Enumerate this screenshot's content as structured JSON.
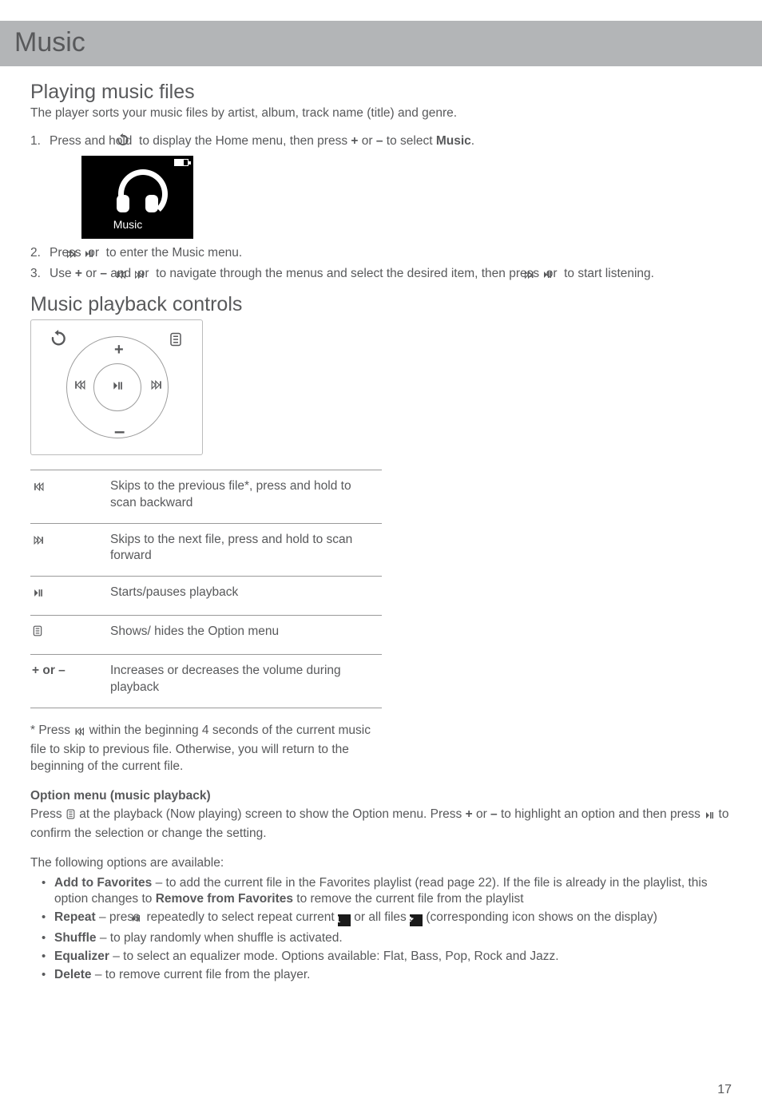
{
  "band": {
    "title": "Music"
  },
  "s1": {
    "heading": "Playing music files",
    "intro": "The player sorts your music files by artist, album, track name (title) and genre.",
    "steps": {
      "s1a": "Press and hold ",
      "s1b": " to display the Home menu, then press ",
      "plus": "+",
      "s1c": " or ",
      "minus": "–",
      "s1d": " to select ",
      "bold1": "Music",
      "s1e": ".",
      "s2a": "Press ",
      "s2b": " or ",
      "s2c": " to enter the Music menu.",
      "s3a": "Use ",
      "s3b": " or ",
      "s3c": " and ",
      "s3d": " or ",
      "s3e": " to navigate through the menus and select the desired item, then press ",
      "s3f": " or ",
      "s3g": " to start listening."
    },
    "thumb_label": "Music"
  },
  "s2": {
    "heading": "Music playback controls",
    "table": {
      "r1": "Skips to the previous file*, press and hold to scan backward",
      "r2": "Skips to the next file, press and hold to scan forward",
      "r3": "Starts/pauses playback",
      "r4": "Shows/ hides the Option menu",
      "r5k": "+ or –",
      "r5": "Increases or decreases the volume during playback"
    },
    "note_a": "* Press ",
    "note_b": " within the beginning 4 seconds of the current music file to skip to previous file. Otherwise, you will return to the beginning of the current file."
  },
  "opt": {
    "head": "Option menu (music playback)",
    "p1a": "Press ",
    "p1b": " at the playback (Now playing) screen to show the Option menu. Press ",
    "plus": "+",
    "p1c": " or ",
    "minus": "–",
    "p1d": " to highlight an option and then press ",
    "p1e": " to confirm the selection or change the setting.",
    "p2": "The following options are available:",
    "li1a": "Add to Favorites",
    "li1b": " – to add the current file in the Favorites playlist (read page 22). If the file is already in the playlist, this option changes to ",
    "li1c": "Remove from Favorites",
    "li1d": " to remove the current file from the playlist",
    "li2a": "Repeat",
    "li2b": " – press ",
    "li2c": " repeatedly to select repeat current ",
    "li2d": " or all files ",
    "li2e": " (corresponding icon shows on the display)",
    "li3a": "Shuffle",
    "li3b": " –  to play randomly when shuffle is activated.",
    "li4a": "Equalizer",
    "li4b": " –  to select an equalizer mode. Options available: Flat, Bass, Pop, Rock and Jazz.",
    "li5a": "Delete",
    "li5b": " – to remove current file from the player."
  },
  "page_number": "17",
  "glyphs": {
    "back_arrow": "↺",
    "prev": "⦉⟨",
    "next": "⟩⦊"
  }
}
